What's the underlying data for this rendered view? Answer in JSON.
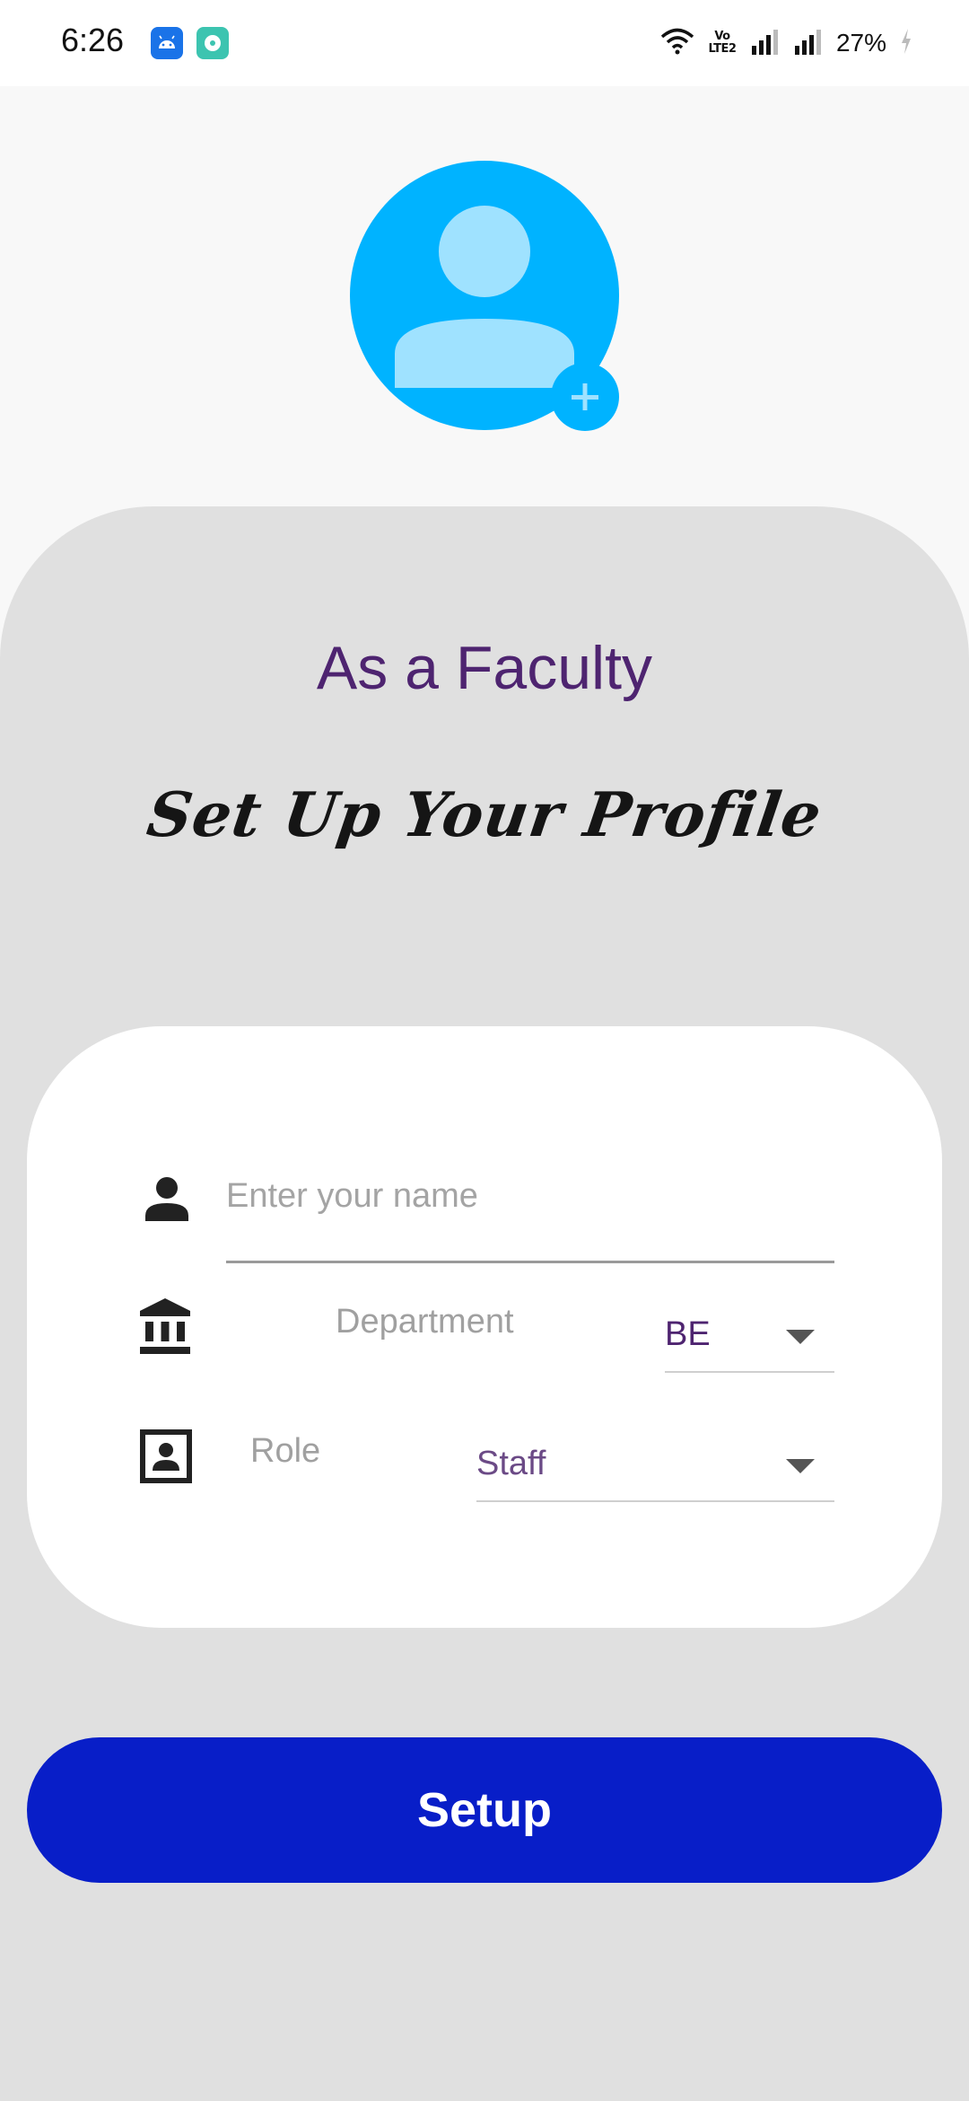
{
  "status_bar": {
    "time": "6:26",
    "volte": "Vo LTE2",
    "battery": "27%",
    "icons": [
      "android-notification-icon",
      "app-notification-icon",
      "wifi-icon",
      "volte-icon",
      "signal-icon",
      "signal-icon",
      "battery-charging-icon"
    ]
  },
  "avatar": {
    "icon": "person-placeholder-icon",
    "add_icon": "add-photo-plus-icon"
  },
  "header": {
    "role_title": "As a Faculty",
    "heading": "Set Up Your Profile"
  },
  "form": {
    "name": {
      "icon": "person-icon",
      "placeholder": "Enter your name",
      "value": ""
    },
    "department": {
      "icon": "institution-icon",
      "label": "Department",
      "selected": "BE"
    },
    "role": {
      "icon": "contact-card-icon",
      "label": "Role",
      "selected": "Staff"
    }
  },
  "actions": {
    "setup_label": "Setup"
  },
  "colors": {
    "accent_purple": "#4e2470",
    "avatar_blue": "#00b3ff",
    "button_blue": "#081ec8",
    "sheet_gray": "#e0e0e0"
  }
}
